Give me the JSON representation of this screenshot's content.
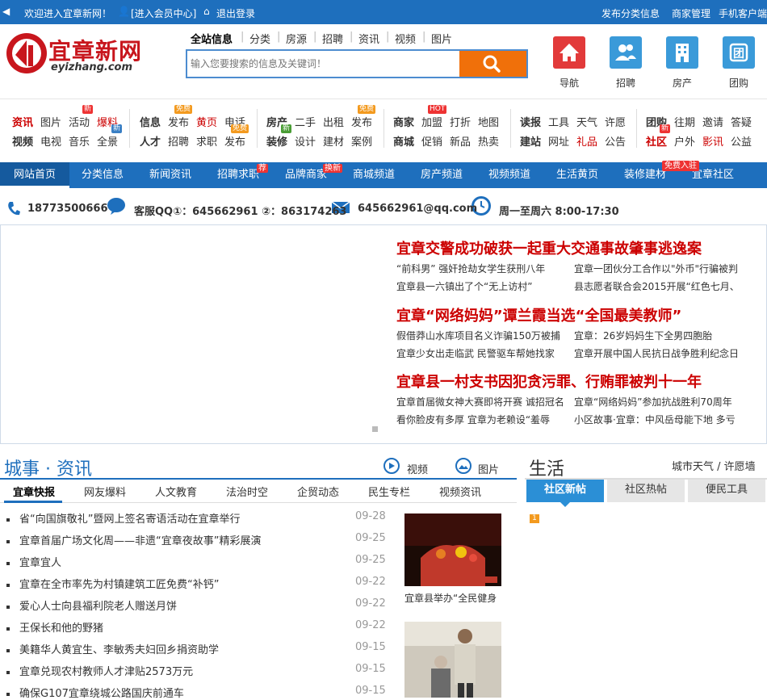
{
  "topbar": {
    "welcome": "欢迎进入宜章新网！",
    "member": "[进入会员中心]",
    "logout": "退出登录",
    "links": [
      "发布分类信息",
      "商家管理",
      "手机客户端"
    ]
  },
  "logo": {
    "cn": "宜章新网",
    "en": "eyizhang.com"
  },
  "search": {
    "tabs": [
      "全站信息",
      "分类",
      "房源",
      "招聘",
      "资讯",
      "视频",
      "图片"
    ],
    "placeholder": "输入您要搜索的信息及关键词！"
  },
  "quick": [
    {
      "label": "导航",
      "color": "#e23a3a"
    },
    {
      "label": "招聘",
      "color": "#3a9ad9"
    },
    {
      "label": "房产",
      "color": "#3a9ad9"
    },
    {
      "label": "团购",
      "color": "#3a9ad9"
    }
  ],
  "categories": {
    "g1r1": [
      "资讯",
      "图片",
      "活动",
      "爆料"
    ],
    "g1r2": [
      "视频",
      "电视",
      "音乐",
      "全景"
    ],
    "g2r1": [
      "信息",
      "发布",
      "黄页",
      "电话"
    ],
    "g2r2": [
      "人才",
      "招聘",
      "求职",
      "发布"
    ],
    "g3r1": [
      "房产",
      "二手",
      "出租",
      "发布"
    ],
    "g3r2": [
      "装修",
      "设计",
      "建材",
      "案例"
    ],
    "g4r1": [
      "商家",
      "加盟",
      "打折",
      "地图"
    ],
    "g4r2": [
      "商城",
      "促销",
      "新品",
      "热卖"
    ],
    "g5r1": [
      "读报",
      "工具",
      "天气",
      "许愿"
    ],
    "g5r2": [
      "建站",
      "网址",
      "礼品",
      "公告"
    ],
    "g6r1": [
      "团购",
      "往期",
      "邀请",
      "答疑"
    ],
    "g6r2": [
      "社区",
      "户外",
      "影讯",
      "公益"
    ],
    "badges": {
      "new": "新",
      "free": "免费",
      "hot": "HOT"
    }
  },
  "nav": {
    "items": [
      "网站首页",
      "分类信息",
      "新闻资讯",
      "招聘求职",
      "品牌商家",
      "商城频道",
      "房产频道",
      "视频频道",
      "生活黄页",
      "装修建材",
      "宜章社区"
    ],
    "badges": {
      "tui": "荐",
      "huanxin": "换新",
      "free": "免费入驻"
    }
  },
  "contact": {
    "phone": "18773500666",
    "qq": "客服QQ①：645662961 ②：863174263",
    "email": "645662961@qq.com",
    "hours": "周一至周六 8:00-17:30"
  },
  "headlines": [
    {
      "title": "宜章交警成功破获一起重大交通事故肇事逃逸案",
      "items": [
        "“前科男” 强奸抢劫女学生获刑八年",
        "宜章一团伙分工合作以\"外币\"行骗被判",
        "宜章县一六镇出了个“无上访村”",
        "县志愿者联合会2015开展“红色七月、"
      ]
    },
    {
      "title": "宜章“网络妈妈”谭兰霞当选“全国最美教师”",
      "items": [
        "假借莽山水库项目名义诈骗150万被捕",
        "宜章：26岁妈妈生下全男四胞胎",
        "宜章少女出走临武 民警驱车帮她找家",
        "宜章开展中国人民抗日战争胜利纪念日"
      ]
    },
    {
      "title": "宜章县一村支书因犯贪污罪、行贿罪被判十一年",
      "items": [
        "宜章首届微女神大赛即将开赛 诚招冠名",
        "宜章“网络妈妈”参加抗战胜利70周年",
        "看你脸皮有多厚 宜章为老赖设“羞辱",
        "小区故事·宜章：中风岳母能下地 多亏"
      ]
    }
  ],
  "city": {
    "title": "城事 · 资讯",
    "video": "视频",
    "image": "图片",
    "tabs": [
      "宜章快报",
      "网友爆料",
      "人文教育",
      "法治时空",
      "企贸动态",
      "民生专栏",
      "视频资讯"
    ],
    "news": [
      {
        "t": "省“向国旗敬礼”暨网上签名寄语活动在宜章举行",
        "d": "09-28"
      },
      {
        "t": "宜章首届广场文化周——非遗“宜章夜故事”精彩展演",
        "d": "09-25"
      },
      {
        "t": "宜章宜人",
        "d": "09-25"
      },
      {
        "t": "宜章在全市率先为村镇建筑工匠免费“补钙”",
        "d": "09-22"
      },
      {
        "t": "爱心人士向县福利院老人赠送月饼",
        "d": "09-22"
      },
      {
        "t": "王保长和他的野猪",
        "d": "09-22"
      },
      {
        "t": "美籍华人黄宜生、李敏秀夫妇回乡捐资助学",
        "d": "09-15"
      },
      {
        "t": "宜章兑现农村教师人才津贴2573万元",
        "d": "09-15"
      },
      {
        "t": "确保G107宜章绕城公路国庆前通车",
        "d": "09-15"
      }
    ],
    "photo_caption": "宜章县举办“全民健身"
  },
  "life": {
    "title": "生活",
    "links": "城市天气 / 许愿墙",
    "tabs": [
      "社区新帖",
      "社区热帖",
      "便民工具"
    ],
    "num": "1"
  }
}
